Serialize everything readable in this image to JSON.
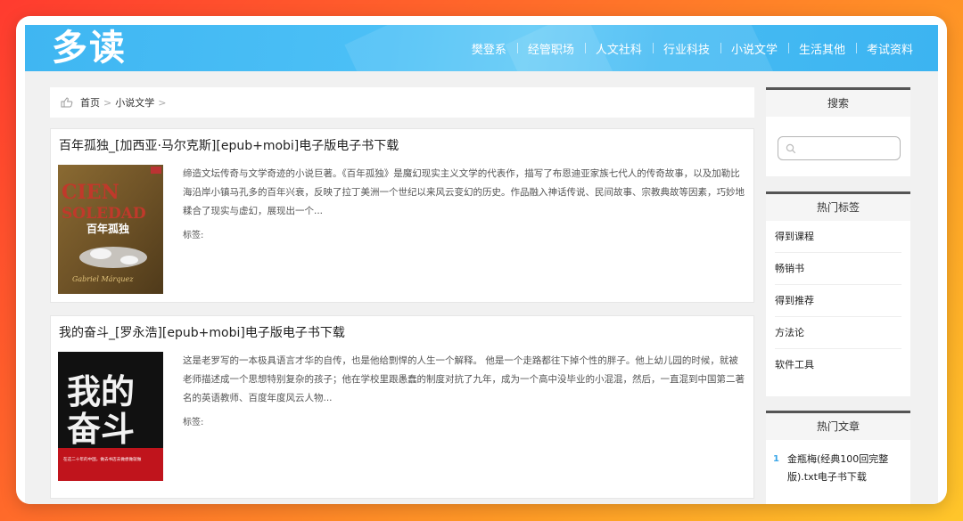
{
  "site": {
    "logo": "多读",
    "nav": [
      "樊登系",
      "经管职场",
      "人文社科",
      "行业科技",
      "小说文学",
      "生活其他",
      "考试资料"
    ]
  },
  "breadcrumb": {
    "home": "首页",
    "sep1": ">",
    "category": "小说文学",
    "sep2": ">"
  },
  "articles": [
    {
      "title": "百年孤独_[加西亚·马尔克斯][epub+mobi]电子版电子书下载",
      "description": "缔造文坛传奇与文学奇迹的小说巨著。《百年孤独》是魔幻现实主义文学的代表作，描写了布恩迪亚家族七代人的传奇故事，以及加勒比海沿岸小镇马孔多的百年兴衰，反映了拉丁美洲一个世纪以来风云变幻的历史。作品融入神话传说、民间故事、宗教典故等因素，巧妙地糅合了现实与虚幻，展现出一个...",
      "tags": "标签:",
      "cover": {
        "line1": "CIEN",
        "line2": "SOLEDAD",
        "cn_title": "百年孤独",
        "author": "Gabriel Márquez"
      }
    },
    {
      "title": "我的奋斗_[罗永浩][epub+mobi]电子版电子书下载",
      "description": "这是老罗写的一本极具语言才华的自传，也是他给剽悍的人生一个解释。 他是一个走路都往下掉个性的胖子。他上幼儿园的时候，就被老师描述成一个思想特别复杂的孩子；他在学校里跟愚蠢的制度对抗了九年，成为一个高中没毕业的小混混，然后，一直混到中国第二著名的英语教师、百度年度风云人物...",
      "tags": "标签:",
      "cover": {
        "line1": "我的",
        "line2": "奋斗",
        "strip": "在这二十年的中国，做去书店去做想做就做"
      }
    }
  ],
  "sidebar": {
    "search": {
      "title": "搜索",
      "placeholder": ""
    },
    "tags": {
      "title": "热门标签",
      "items": [
        "得到课程",
        "畅销书",
        "得到推荐",
        "方法论",
        "软件工具"
      ]
    },
    "hot": {
      "title": "热门文章",
      "items": [
        {
          "num": "1",
          "title": "金瓶梅(经典100回完整版).txt电子书下载"
        }
      ]
    }
  },
  "colors": {
    "header": "#46bbf3",
    "accent": "#3aa6e8",
    "background": "#f1f1f1"
  }
}
